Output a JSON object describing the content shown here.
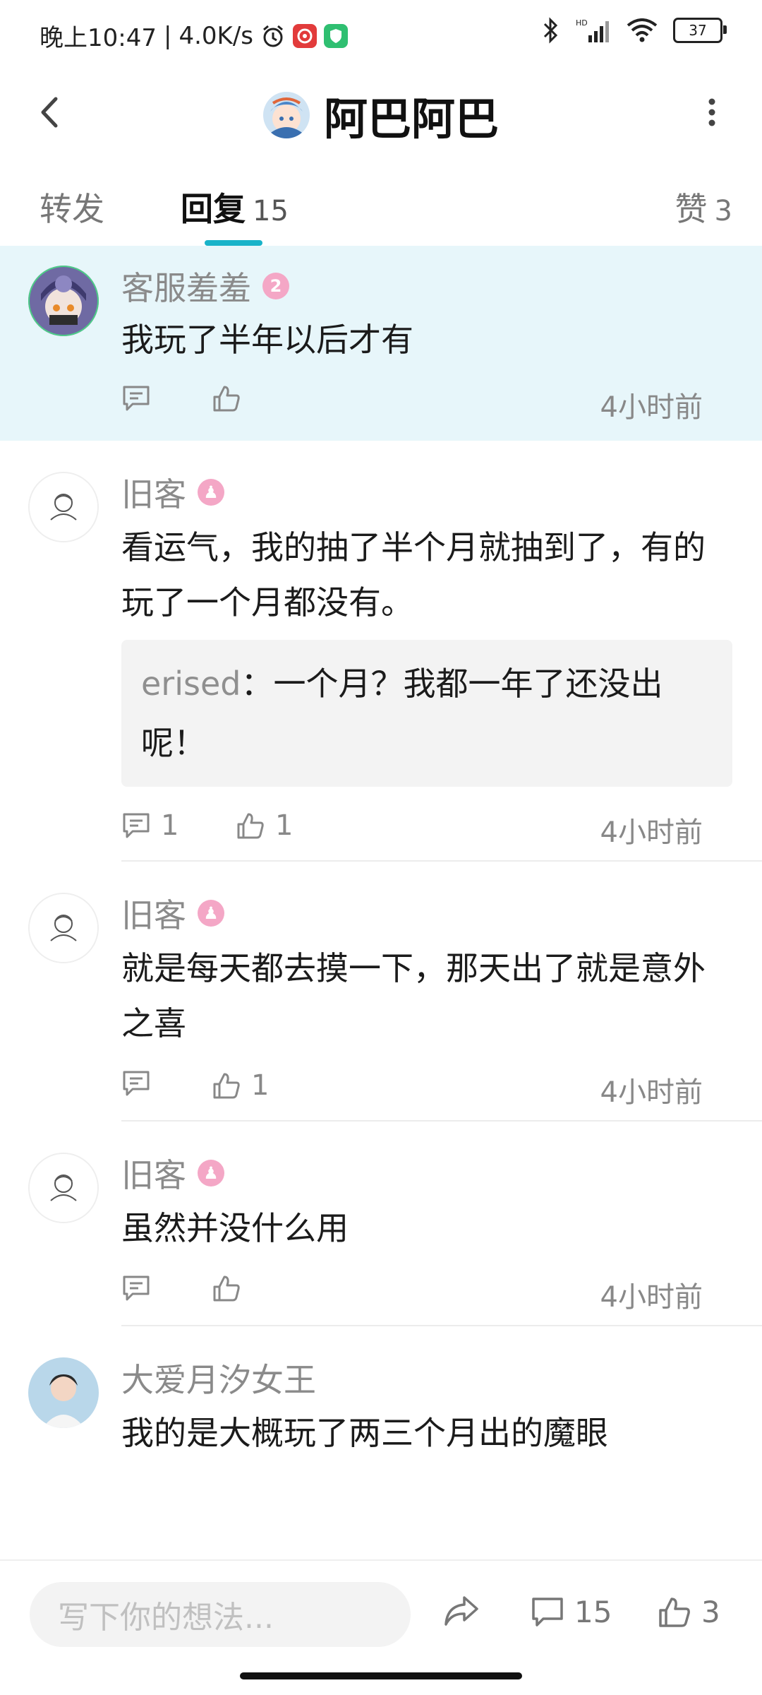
{
  "status_bar": {
    "time_text": "晚上10:47",
    "speed_text": "4.0K/s",
    "battery_level": "37"
  },
  "header": {
    "title": "阿巴阿巴"
  },
  "tabs": [
    {
      "label": "转发",
      "count": ""
    },
    {
      "label": "回复",
      "count": "15"
    },
    {
      "label": "赞",
      "count": "3"
    }
  ],
  "comments": [
    {
      "username": "客服羞羞",
      "badge": "2",
      "content": "我玩了半年以后才有",
      "reply_count": "",
      "like_count": "",
      "time": "4小时前"
    },
    {
      "username": "旧客",
      "badge": "",
      "content": "看运气，我的抽了半个月就抽到了，有的玩了一个月都没有。",
      "quote_name": "erised",
      "quote_text": "：一个月？我都一年了还没出呢！",
      "reply_count": "1",
      "like_count": "1",
      "time": "4小时前"
    },
    {
      "username": "旧客",
      "badge": "",
      "content": "就是每天都去摸一下，那天出了就是意外之喜",
      "reply_count": "",
      "like_count": "1",
      "time": "4小时前"
    },
    {
      "username": "旧客",
      "badge": "",
      "content": "虽然并没什么用",
      "reply_count": "",
      "like_count": "",
      "time": "4小时前"
    },
    {
      "username": "大爱月汐女王",
      "badge": "",
      "content": "我的是大概玩了两三个月出的魔眼"
    }
  ],
  "bottom_bar": {
    "input_placeholder": "写下你的想法...",
    "comment_count": "15",
    "like_count": "3"
  }
}
